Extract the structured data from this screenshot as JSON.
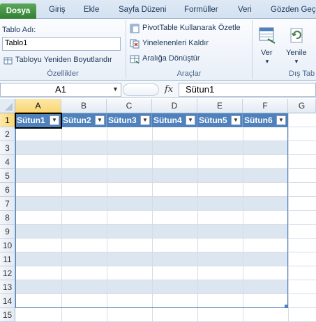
{
  "tabs": {
    "file": "Dosya",
    "home": "Giriş",
    "insert": "Ekle",
    "page_layout": "Sayfa Düzeni",
    "formulas": "Formüller",
    "data": "Veri",
    "review": "Gözden Geçi"
  },
  "ribbon": {
    "table_name_label": "Tablo Adı:",
    "table_name_value": "Tablo1",
    "resize_table": "Tabloyu Yeniden Boyutlandır",
    "group_properties": "Özellikler",
    "pivot_summary": "PivotTable Kullanarak Özetle",
    "remove_duplicates": "Yinelenenleri Kaldır",
    "convert_to_range": "Aralığa Dönüştür",
    "group_tools": "Araçlar",
    "export": "Ver",
    "refresh": "Yenile",
    "group_external": "Dış Tab"
  },
  "formula_bar": {
    "name_box": "A1",
    "fx": "fx",
    "content": "Sütun1"
  },
  "sheet": {
    "columns": [
      "A",
      "B",
      "C",
      "D",
      "E",
      "F",
      "G"
    ],
    "rows": [
      "1",
      "2",
      "3",
      "4",
      "5",
      "6",
      "7",
      "8",
      "9",
      "10",
      "11",
      "12",
      "13",
      "14",
      "15"
    ],
    "table_headers": [
      "Sütun1",
      "Sütun2",
      "Sütun3",
      "Sütun4",
      "Sütun5",
      "Sütun6"
    ]
  },
  "colors": {
    "table_header": "#4f81bd",
    "band": "#dce6f1",
    "file_tab": "#2e7d32"
  }
}
